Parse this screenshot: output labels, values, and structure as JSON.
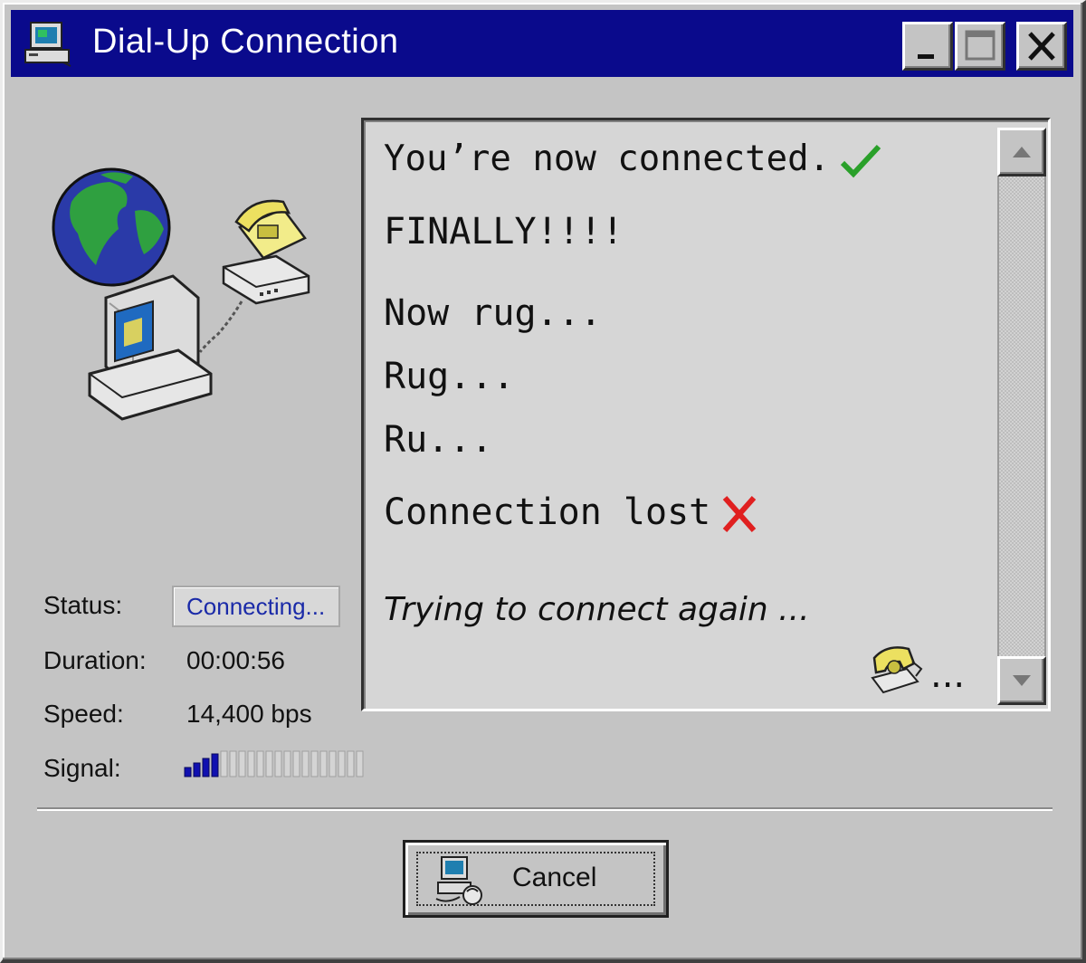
{
  "window": {
    "title": "Dial-Up Connection",
    "title_bar_color": "#0a0a8c",
    "face_color": "#c4c4c4"
  },
  "title_buttons": {
    "minimize_icon": "minimize-icon",
    "maximize_icon": "maximize-icon",
    "close_icon": "close-icon"
  },
  "illustration": {
    "icons": [
      "globe-icon",
      "computer-icon",
      "telephone-icon",
      "modem-icon"
    ]
  },
  "info": {
    "status_label": "Status:",
    "status_value": "Connecting...",
    "duration_label": "Duration:",
    "duration_value": "00:00:56",
    "speed_label": "Speed:",
    "speed_value": "14,400 bps",
    "signal_label": "Signal:",
    "signal_level": 0.2,
    "signal_color": "#1010b0"
  },
  "messages": {
    "line1": "You’re now connected.",
    "line2": "FINALLY!!!!",
    "line3": "Now rug...",
    "line4": "Rug...",
    "line5": "Ru...",
    "line6": "Connection lost",
    "line7": "Trying to connect again ...",
    "tail_dots": "...",
    "check_color": "#2aa02a",
    "x_color": "#e02020"
  },
  "buttons": {
    "cancel_label": "Cancel"
  }
}
